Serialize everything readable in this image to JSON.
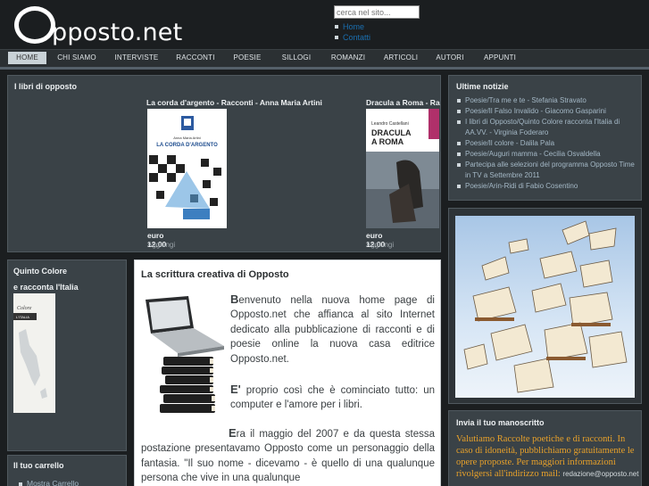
{
  "header": {
    "logo_text": "pposto.net",
    "search_placeholder": "cerca nel sito...",
    "toplinks": [
      "Home",
      "Contatti"
    ]
  },
  "nav": {
    "items": [
      "HOME",
      "CHI SIAMO",
      "INTERVISTE",
      "RACCONTI",
      "POESIE",
      "SILLOGI",
      "ROMANZI",
      "ARTICOLI",
      "AUTORI",
      "APPUNTI"
    ],
    "active": "HOME"
  },
  "books_box": {
    "title": "I libri di opposto",
    "books": [
      {
        "title": "La corda d'argento - Racconti - Anna Maria Artini",
        "cover_title": "LA CORDA D'ARGENTO",
        "cover_author": "Anna Maria Artini",
        "price": "euro 12.00",
        "add": "Aggiungi"
      },
      {
        "title": "Dracula a Roma - Ra",
        "cover_title": "DRACULA A ROMA",
        "cover_author": "Leandro Castellani",
        "price": "euro 12.00",
        "add": "Aggiungi"
      }
    ]
  },
  "news": {
    "title": "Ultime notizie",
    "items": [
      "Poesie/Tra me e te - Stefania Stravato",
      "Poesie/Il Falso Invalido - Giacomo Gasparini",
      "I libri di Opposto/Quinto Colore racconta l'Italia di AA.VV. - Virginia Foderaro",
      "Poesie/Il colore - Dalila Pala",
      "Poesie/Auguri mamma - Cecilia Osvaldella",
      "Partecipa alle selezioni del programma Opposto Time in TV a Settembre 2011",
      "Poesie/Arin-Ridi di Fabio Cosentino"
    ]
  },
  "submit": {
    "title": "Invia il tuo manoscritto",
    "text": "Valutiamo Raccolte poetiche e di racconti. In caso di idoneità, pubblichiamo gratuitamente le opere proposte. Per maggiori informazioni rivolgersi all'indirizzo mail:",
    "email": "redazione@opposto.net"
  },
  "quinto": {
    "title": "Quinto Colore",
    "subtitle": "e racconta l'Italia",
    "cover_text": "Colore",
    "cover_sub": "L'ITALIA"
  },
  "cart": {
    "title": "Il tuo carrello",
    "link": "Mostra Carrello"
  },
  "main": {
    "title": "La scrittura creativa di Opposto",
    "p1_cap": "B",
    "p1": "envenuto nella nuova home page di Opposto.net che affianca al sito Internet dedicato alla pubblicazione di racconti e di poesie online la nuova casa editrice Opposto.net.",
    "p2_cap": "E'",
    "p2": " proprio così che è cominciato tutto: un computer e l'amore per i libri.",
    "p3_cap": "E",
    "p3": "ra il maggio del 2007 e da questa stessa postazione presentavamo Opposto come un personaggio della fantasia. \"Il suo nome - dicevamo - è quello di una qualunque persona che vive in una qualunque"
  },
  "colors": {
    "background": "#1b1e20",
    "panel": "#3a4247",
    "accent_orange": "#e8a12a",
    "link_blue": "#a4b8c6"
  }
}
